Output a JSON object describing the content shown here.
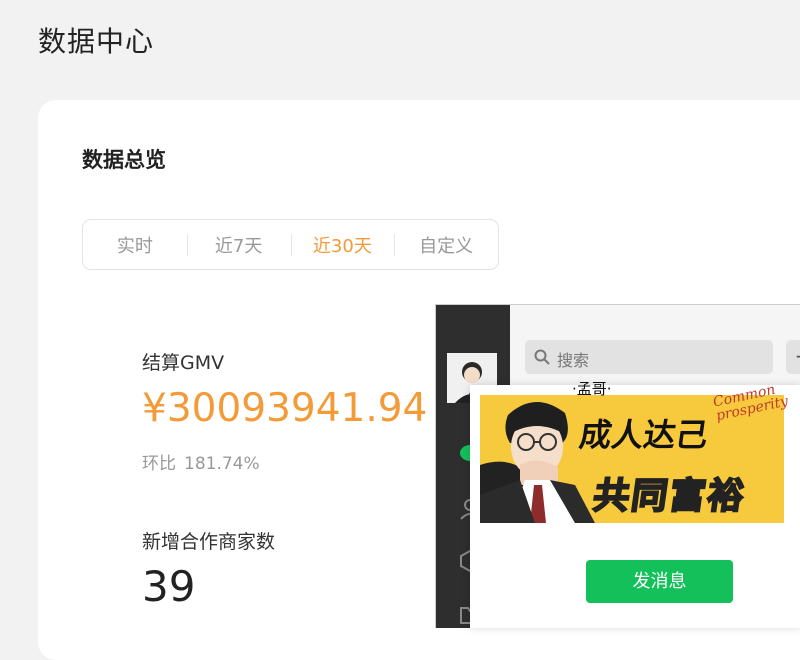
{
  "page": {
    "title": "数据中心"
  },
  "overview": {
    "title": "数据总览",
    "tabs": [
      {
        "label": "实时",
        "active": false
      },
      {
        "label": "近7天",
        "active": false
      },
      {
        "label": "近30天",
        "active": true
      },
      {
        "label": "自定义",
        "active": false
      }
    ]
  },
  "metrics": {
    "gmv": {
      "label": "结算GMV",
      "value": "¥30093941.94",
      "ratio_label": "环比",
      "ratio_value": "181.74%"
    },
    "merchants": {
      "label": "新增合作商家数",
      "value": "39"
    }
  },
  "chat": {
    "search_placeholder": "搜索",
    "add_label": "+",
    "nickname": "·孟哥·",
    "banner": {
      "line1": "成人达己",
      "line2": "共同富裕",
      "english": "Common\nprosperity"
    },
    "send_label": "发消息"
  },
  "colors": {
    "accent": "#f29b38",
    "send": "#13c05a",
    "banner": "#f7c93c"
  }
}
